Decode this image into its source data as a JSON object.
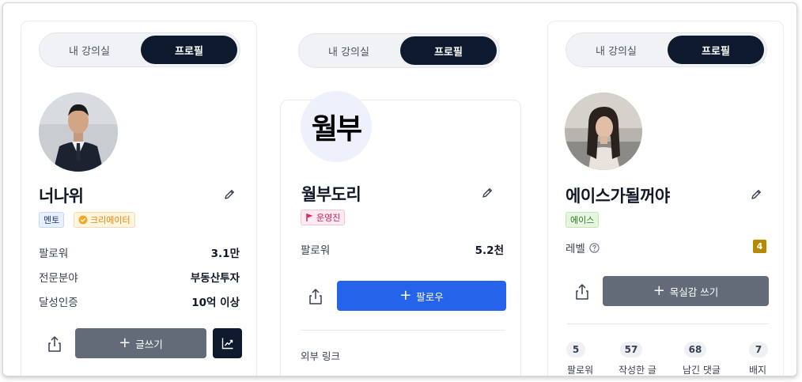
{
  "cards": [
    {
      "tabs": {
        "inactive": "내 강의실",
        "active": "프로필"
      },
      "name": "너나위",
      "badges": {
        "mentor": "멘토",
        "creator": "크리에이터"
      },
      "rows": [
        {
          "label": "팔로워",
          "value": "3.1만"
        },
        {
          "label": "전문분야",
          "value": "부동산투자"
        },
        {
          "label": "달성인증",
          "value": "10억 이상"
        }
      ],
      "primary_button": {
        "icon": "+",
        "label": "글쓰기"
      },
      "icons": [
        "share-icon",
        "edit-icon",
        "trending-up-icon"
      ]
    },
    {
      "tabs": {
        "inactive": "내 강의실",
        "active": "프로필"
      },
      "avatar_text": "월부",
      "name": "월부도리",
      "badges": {
        "staff": "운영진"
      },
      "rows": [
        {
          "label": "팔로워",
          "value": "5.2천"
        }
      ],
      "primary_button": {
        "icon": "+",
        "label": "팔로우"
      },
      "external_link_label": "외부 링크",
      "icons": [
        "share-icon",
        "edit-icon",
        "flag-icon"
      ]
    },
    {
      "tabs": {
        "inactive": "내 강의실",
        "active": "프로필"
      },
      "name": "에이스가될꺼야",
      "badges": {
        "ace": "에이스"
      },
      "level": {
        "label": "레벨",
        "value": "4"
      },
      "primary_button": {
        "icon": "+",
        "label": "목실감 쓰기"
      },
      "stats": [
        {
          "value": "5",
          "label": "팔로워"
        },
        {
          "value": "57",
          "label": "작성한 글"
        },
        {
          "value": "68",
          "label": "남긴 댓글"
        },
        {
          "value": "7",
          "label": "배지"
        }
      ],
      "icons": [
        "share-icon",
        "edit-icon",
        "help-icon"
      ]
    }
  ],
  "colors": {
    "active_tab": "#0d1a2e",
    "follow_button": "#2563eb",
    "disabled_button": "#646b78",
    "level_badge": "#b58a00",
    "mentor_badge": "#1e3a8a",
    "creator_badge": "#e08a00",
    "staff_badge": "#d11a56",
    "ace_badge": "#2e7d1f"
  }
}
